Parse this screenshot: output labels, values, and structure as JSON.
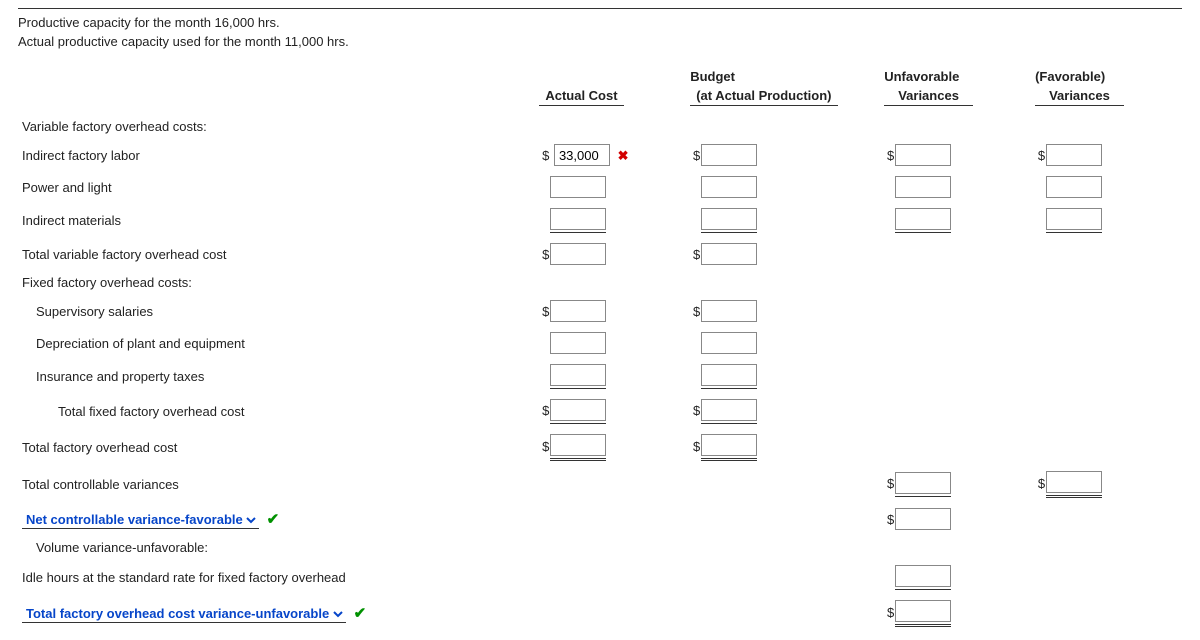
{
  "intro": {
    "line1": "Productive capacity for the month 16,000 hrs.",
    "line2": "Actual productive capacity used for the month 11,000 hrs."
  },
  "headers": {
    "actual": "Actual Cost",
    "budget_l1": "Budget",
    "budget_l2": "(at Actual Production)",
    "unfav_l1": "Unfavorable",
    "unfav_l2": "Variances",
    "fav_l1": "(Favorable)",
    "fav_l2": "Variances"
  },
  "rows": {
    "var_hdr": "Variable factory overhead costs:",
    "indirect_labor": "Indirect factory labor",
    "indirect_labor_val": "33,000",
    "power": "Power and light",
    "indirect_materials": "Indirect materials",
    "total_var": "Total variable factory overhead cost",
    "fixed_hdr": "Fixed factory overhead costs:",
    "supervisory": "Supervisory salaries",
    "depreciation": "Depreciation of plant and equipment",
    "insurance": "Insurance and property taxes",
    "total_fixed": "Total fixed factory overhead cost",
    "total_ovh": "Total factory overhead cost",
    "total_ctrl": "Total controllable variances",
    "net_ctrl": "Net controllable variance-favorable",
    "vol_var": "Volume variance-unfavorable:",
    "idle": "Idle hours at the standard rate for fixed factory overhead",
    "total_cost_var": "Total factory overhead cost variance-unfavorable"
  },
  "marks": {
    "x": "✖",
    "check": "✔",
    "caret": "▾"
  }
}
